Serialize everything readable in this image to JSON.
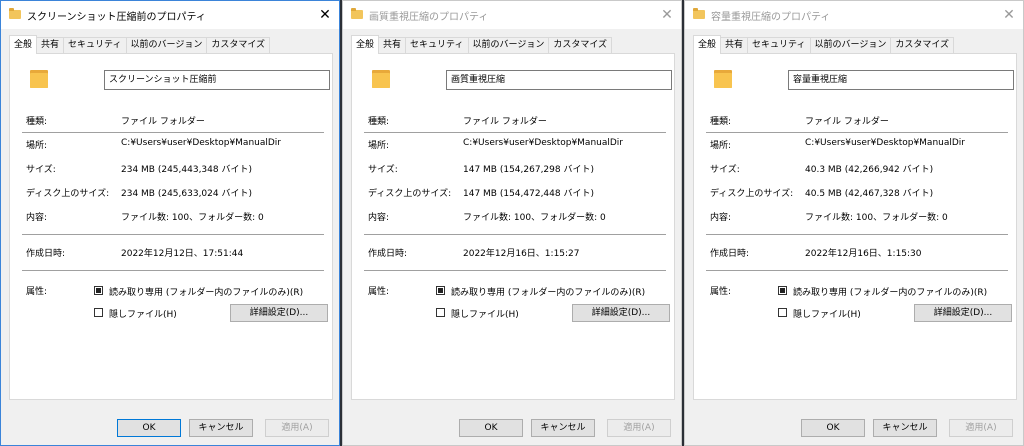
{
  "labels": {
    "type": "種類:",
    "location": "場所:",
    "size": "サイズ:",
    "size_on_disk": "ディスク上のサイズ:",
    "contains": "内容:",
    "created": "作成日時:",
    "attributes": "属性:"
  },
  "tabs": [
    "全般",
    "共有",
    "セキュリティ",
    "以前のバージョン",
    "カスタマイズ"
  ],
  "attr": {
    "readonly": "読み取り専用 (フォルダー内のファイルのみ)(R)",
    "hidden": "隠しファイル(H)",
    "advanced": "詳細設定(D)..."
  },
  "buttons": {
    "ok": "OK",
    "cancel": "キャンセル",
    "apply": "適用(A)"
  },
  "close_glyph": "✕",
  "dialogs": [
    {
      "title": "スクリーンショット圧縮前のプロパティ",
      "name": "スクリーンショット圧縮前",
      "type": "ファイル フォルダー",
      "location": "C:¥Users¥user¥Desktop¥ManualDir",
      "size": "234 MB (245,443,348 バイト)",
      "size_on_disk": "234 MB (245,633,024 バイト)",
      "contains": "ファイル数: 100、フォルダー数: 0",
      "created": "2022年12月12日、17:51:44",
      "active": true
    },
    {
      "title": "画質重視圧縮のプロパティ",
      "name": "画質重視圧縮",
      "type": "ファイル フォルダー",
      "location": "C:¥Users¥user¥Desktop¥ManualDir",
      "size": "147 MB (154,267,298 バイト)",
      "size_on_disk": "147 MB (154,472,448 バイト)",
      "contains": "ファイル数: 100、フォルダー数: 0",
      "created": "2022年12月16日、1:15:27",
      "active": false
    },
    {
      "title": "容量重視圧縮のプロパティ",
      "name": "容量重視圧縮",
      "type": "ファイル フォルダー",
      "location": "C:¥Users¥user¥Desktop¥ManualDir",
      "size": "40.3 MB (42,266,942 バイト)",
      "size_on_disk": "40.5 MB (42,467,328 バイト)",
      "contains": "ファイル数: 100、フォルダー数: 0",
      "created": "2022年12月16日、1:15:30",
      "active": false
    }
  ],
  "colors": {
    "active_border": "#3b84d9",
    "folder": "#f8c44f",
    "default_button_border": "#0078d7"
  }
}
